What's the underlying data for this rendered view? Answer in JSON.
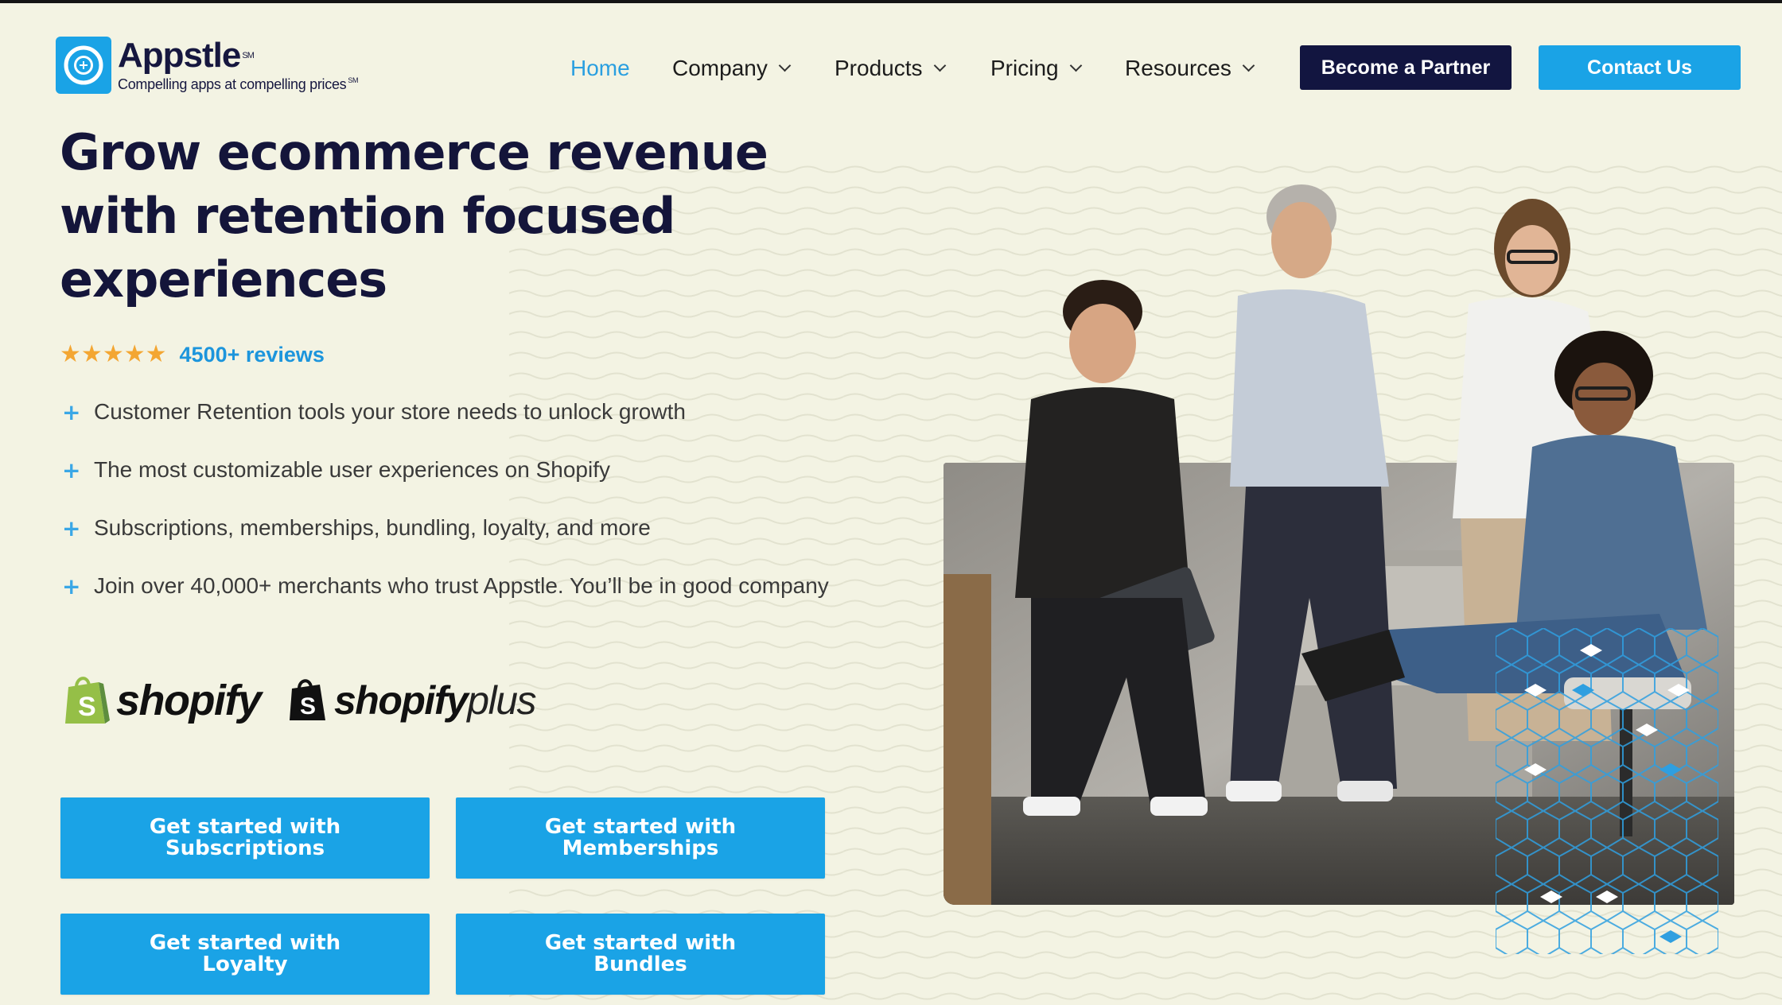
{
  "header": {
    "logo": {
      "name": "Appstle",
      "sm_mark": "SM",
      "tagline": "Compelling apps at compelling prices",
      "tagline_sm": "SM",
      "icon": "appstle-logo-icon"
    },
    "nav": {
      "home": "Home",
      "company": "Company",
      "products": "Products",
      "pricing": "Pricing",
      "resources": "Resources"
    },
    "become_partner": "Become a Partner",
    "contact_us": "Contact Us"
  },
  "hero": {
    "headline": [
      "Grow ecommerce revenue",
      "with retention focused",
      "experiences"
    ],
    "rating": {
      "stars": 5,
      "reviews": "4500+ reviews"
    },
    "bullets": [
      "Customer Retention tools your store needs to unlock growth",
      "The most customizable user experiences on Shopify",
      "Subscriptions, memberships, bundling, loyalty, and more",
      "Join over 40,000+ merchants who trust Appstle. You’ll be in good company"
    ],
    "partners": {
      "shopify": "shopify",
      "shopify_plus_bold": "shopify",
      "shopify_plus_light": "plus"
    },
    "ctas": [
      {
        "line1": "Get started with",
        "line2": "Subscriptions"
      },
      {
        "line1": "Get started with",
        "line2": "Memberships"
      },
      {
        "line1": "Get started with",
        "line2": "Loyalty"
      },
      {
        "line1": "Get started with",
        "line2": "Bundles"
      }
    ]
  },
  "colors": {
    "background": "#f3f3e3",
    "brand_blue": "#1aa3e6",
    "navy": "#121540",
    "star": "#f3a632",
    "shopify_green": "#95bf47"
  }
}
